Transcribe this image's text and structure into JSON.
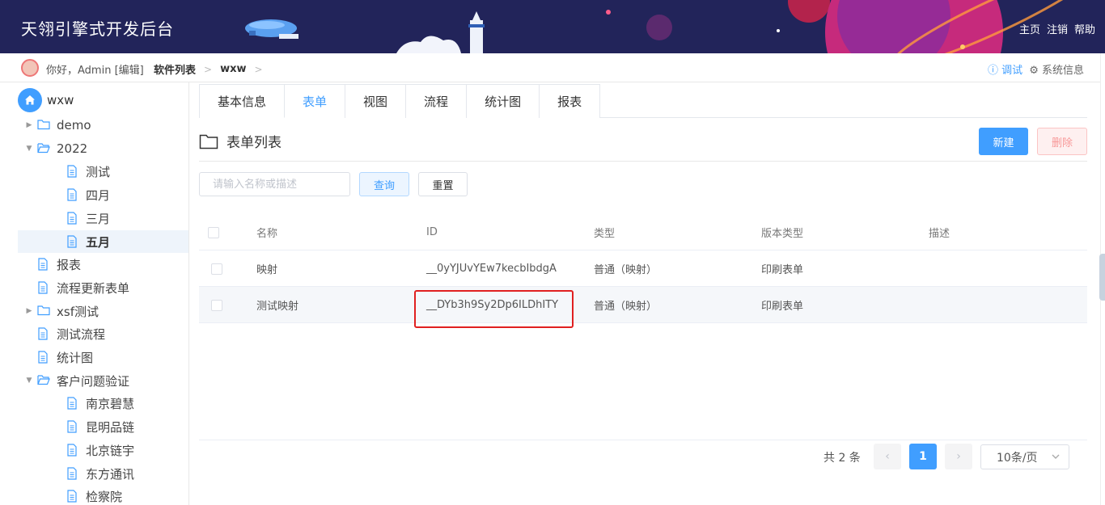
{
  "app": {
    "title": "天翎引擎式开发后台"
  },
  "header_nav": [
    "主页",
    "注销",
    "帮助"
  ],
  "topbar": {
    "greeting": "你好，Admin [编辑]",
    "breadcrumbs": [
      "软件列表",
      "wxw"
    ],
    "debug": "调试",
    "system_info": "系统信息"
  },
  "sidebar": {
    "root": "wxw",
    "items": [
      {
        "label": "demo",
        "type": "folder",
        "expanded": false,
        "level": 0
      },
      {
        "label": "2022",
        "type": "folder",
        "expanded": true,
        "level": 0
      },
      {
        "label": "测试",
        "type": "doc",
        "level": 1
      },
      {
        "label": "四月",
        "type": "doc",
        "level": 1
      },
      {
        "label": "三月",
        "type": "doc",
        "level": 1
      },
      {
        "label": "五月",
        "type": "doc",
        "level": 1,
        "selected": true
      },
      {
        "label": "报表",
        "type": "doc",
        "level": 0
      },
      {
        "label": "流程更新表单",
        "type": "doc",
        "level": 0
      },
      {
        "label": "xsf测试",
        "type": "folder",
        "expanded": false,
        "level": 0
      },
      {
        "label": "测试流程",
        "type": "doc",
        "level": 0
      },
      {
        "label": "统计图",
        "type": "doc",
        "level": 0
      },
      {
        "label": "客户问题验证",
        "type": "folder",
        "expanded": true,
        "level": 0
      },
      {
        "label": "南京碧慧",
        "type": "doc",
        "level": 1
      },
      {
        "label": "昆明品链",
        "type": "doc",
        "level": 1
      },
      {
        "label": "北京链宇",
        "type": "doc",
        "level": 1
      },
      {
        "label": "东方通讯",
        "type": "doc",
        "level": 1
      },
      {
        "label": "检察院",
        "type": "doc",
        "level": 1
      }
    ]
  },
  "tabs": [
    "基本信息",
    "表单",
    "视图",
    "流程",
    "统计图",
    "报表"
  ],
  "active_tab": "表单",
  "section": {
    "title": "表单列表",
    "new_label": "新建",
    "delete_label": "删除"
  },
  "search": {
    "placeholder": "请输入名称或描述",
    "query_label": "查询",
    "reset_label": "重置"
  },
  "table": {
    "headers": [
      "名称",
      "ID",
      "类型",
      "版本类型",
      "描述"
    ],
    "rows": [
      [
        "映射",
        "__0yYJUvYEw7kecbIbdgA",
        "普通（映射）",
        "印刷表单",
        ""
      ],
      [
        "测试映射",
        "__DYb3h9Sy2Dp6ILDhITY",
        "普通（映射）",
        "印刷表单",
        ""
      ]
    ]
  },
  "pagination": {
    "total": "共 2 条",
    "current_page": "1",
    "page_size": "10条/页"
  },
  "colors": {
    "header_bg": "#22245a",
    "accent": "#409eff",
    "highlight_box": "#e02020"
  }
}
